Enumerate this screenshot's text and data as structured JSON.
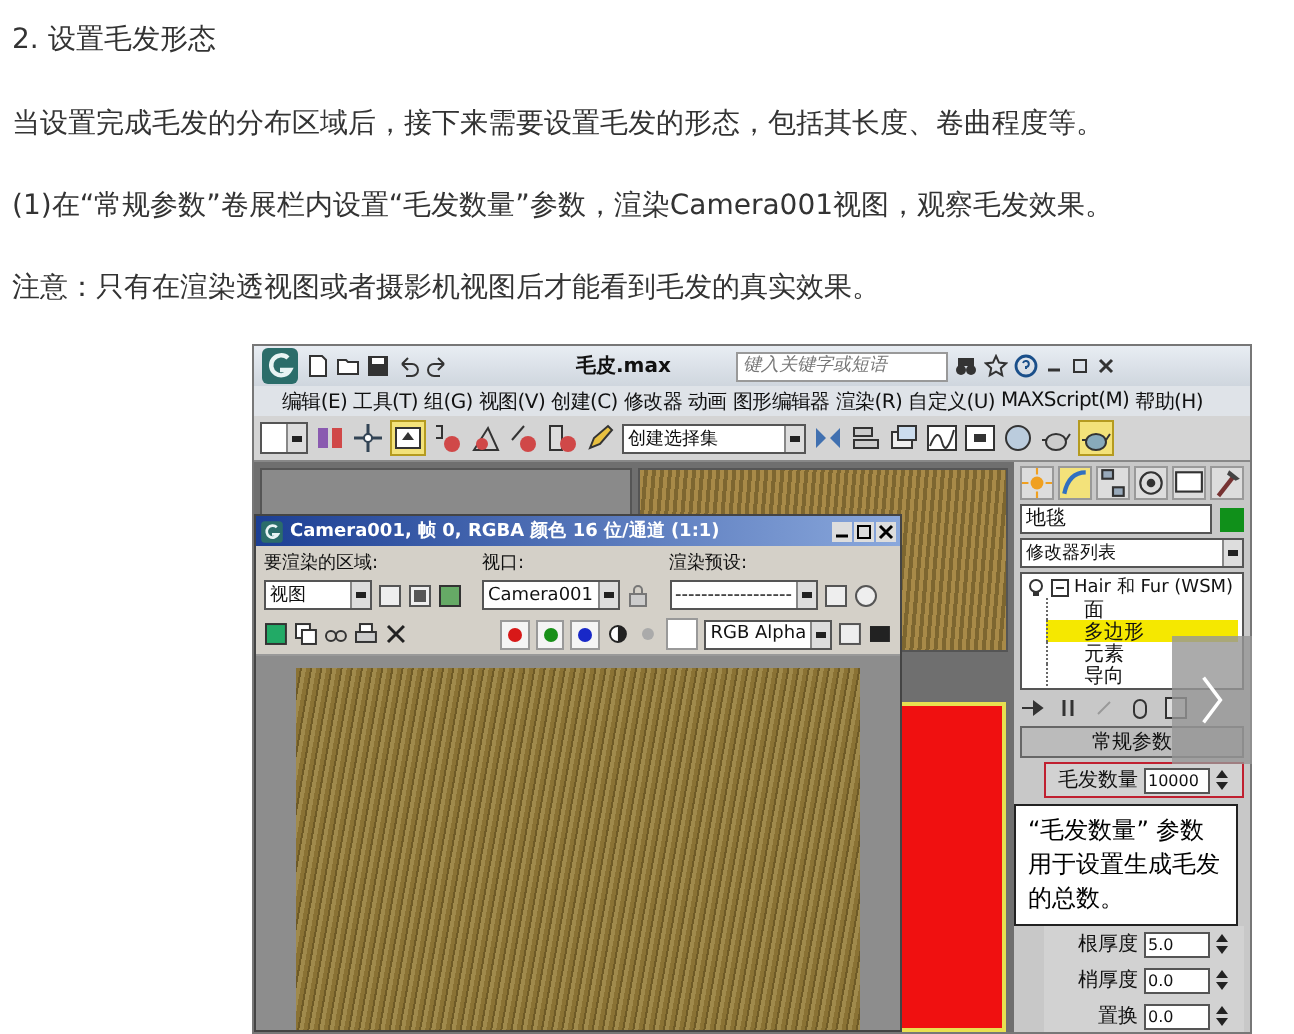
{
  "article": {
    "heading": "2. 设置毛发形态",
    "paragraphs": [
      "当设置完成毛发的分布区域后，接下来需要设置毛发的形态，包括其长度、卷曲程度等。",
      "(1)在“常规参数”卷展栏内设置“毛发数量”参数，渲染Camera001视图，观察毛发效果。",
      "注意：只有在渲染透视图或者摄影机视图后才能看到毛发的真实效果。"
    ]
  },
  "screenshot": {
    "app_title": "毛皮.max",
    "search": {
      "placeholder": "键入关键字或短语"
    },
    "menu": [
      "编辑(E)",
      "工具(T)",
      "组(G)",
      "视图(V)",
      "创建(C)",
      "修改器",
      "动画",
      "图形编辑器",
      "渲染(R)",
      "自定义(U)",
      "MAXScript(M)",
      "帮助(H)"
    ],
    "selection_set": "创建选择集",
    "render_window": {
      "title": "Camera001, 帧 0, RGBA 颜色 16 位/通道 (1:1)",
      "area_label": "要渲染的区域:",
      "area_value": "视图",
      "viewport_label": "视口:",
      "viewport_value": "Camera001",
      "preset_label": "渲染预设:",
      "preset_value": "------------------",
      "channel_value": "RGB Alpha",
      "channels": [
        {
          "color": "#d81818"
        },
        {
          "color": "#189018"
        },
        {
          "color": "#1828c8"
        }
      ]
    },
    "command_panel": {
      "object_name": "地毯",
      "modifier_list": "修改器列表",
      "modifier_stack": [
        {
          "label": "Hair 和 Fur (WSM)",
          "children": [
            {
              "label": "面",
              "selected": false
            },
            {
              "label": "多边形",
              "selected": true
            },
            {
              "label": "元素",
              "selected": false
            },
            {
              "label": "导向",
              "selected": false
            }
          ]
        }
      ],
      "rollout": "常规参数",
      "params": [
        {
          "label": "毛发数量",
          "value": "10000",
          "highlighted": true
        },
        {
          "label": "根厚度",
          "value": "5.0",
          "highlighted": false
        },
        {
          "label": "梢厚度",
          "value": "0.0",
          "highlighted": false
        },
        {
          "label": "置换",
          "value": "0.0",
          "highlighted": false
        }
      ]
    },
    "callout": "“毛发数量” 参数用于设置生成毛发的总数。"
  }
}
